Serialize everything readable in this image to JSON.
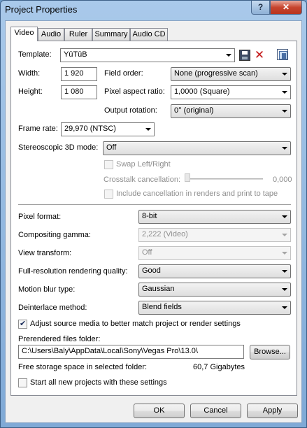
{
  "window": {
    "title": "Project Properties"
  },
  "tabs": [
    "Video",
    "Audio",
    "Ruler",
    "Summary",
    "Audio CD"
  ],
  "video": {
    "template_label": "Template:",
    "template_value": "YūTūB",
    "width_label": "Width:",
    "width_value": "1 920",
    "height_label": "Height:",
    "height_value": "1 080",
    "field_order_label": "Field order:",
    "field_order_value": "None (progressive scan)",
    "pixel_aspect_label": "Pixel aspect ratio:",
    "pixel_aspect_value": "1,0000 (Square)",
    "output_rotation_label": "Output rotation:",
    "output_rotation_value": "0° (original)",
    "frame_rate_label": "Frame rate:",
    "frame_rate_value": "29,970 (NTSC)",
    "stereo_label": "Stereoscopic 3D mode:",
    "stereo_value": "Off",
    "swap_label": "Swap Left/Right",
    "crosstalk_label": "Crosstalk cancellation:",
    "crosstalk_value": "0,000",
    "include_cancel_label": "Include cancellation in renders and print to tape",
    "pixel_format_label": "Pixel format:",
    "pixel_format_value": "8-bit",
    "compositing_gamma_label": "Compositing gamma:",
    "compositing_gamma_value": "2,222 (Video)",
    "view_transform_label": "View transform:",
    "view_transform_value": "Off",
    "render_quality_label": "Full-resolution rendering quality:",
    "render_quality_value": "Good",
    "motion_blur_label": "Motion blur type:",
    "motion_blur_value": "Gaussian",
    "deinterlace_label": "Deinterlace method:",
    "deinterlace_value": "Blend fields",
    "adjust_source_label": "Adjust source media to better match project or render settings",
    "prerendered_label": "Prerendered files folder:",
    "prerendered_value": "C:\\Users\\Baly\\AppData\\Local\\Sony\\Vegas Pro\\13.0\\",
    "browse_label": "Browse...",
    "free_storage_label": "Free storage space in selected folder:",
    "free_storage_value": "60,7 Gigabytes",
    "start_all_label": "Start all new projects with these settings"
  },
  "buttons": {
    "ok": "OK",
    "cancel": "Cancel",
    "apply": "Apply"
  }
}
